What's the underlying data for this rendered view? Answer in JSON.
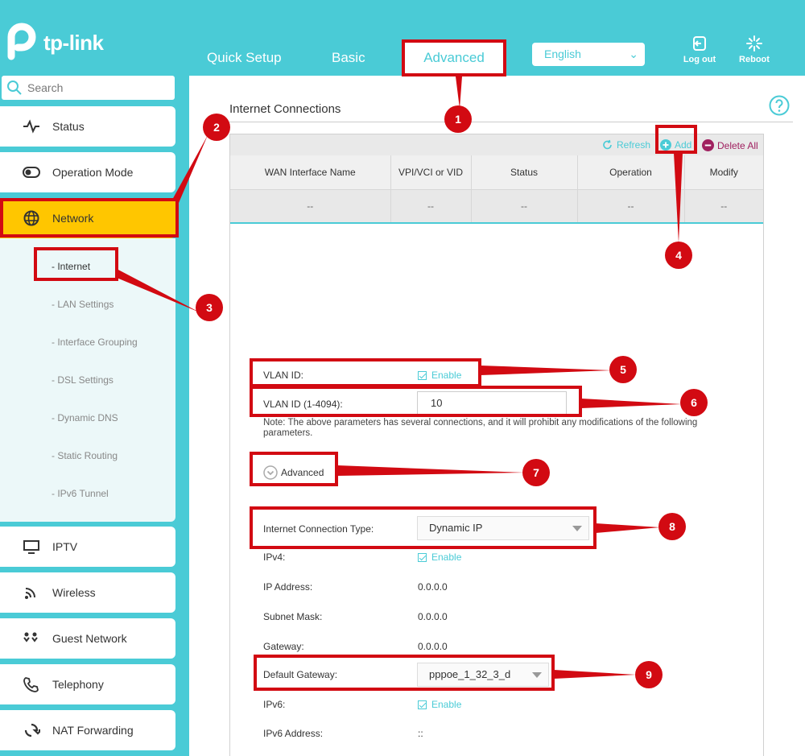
{
  "header": {
    "brand": "tp-link",
    "tabs": [
      {
        "label": "Quick Setup"
      },
      {
        "label": "Basic"
      },
      {
        "label": "Advanced"
      }
    ],
    "language": "English",
    "logout_label": "Log out",
    "reboot_label": "Reboot"
  },
  "sidebar": {
    "search_placeholder": "Search",
    "items": [
      {
        "label": "Status",
        "icon": "pulse-icon"
      },
      {
        "label": "Operation Mode",
        "icon": "toggle-icon"
      },
      {
        "label": "Network",
        "icon": "globe-icon"
      },
      {
        "label": "IPTV",
        "icon": "monitor-icon"
      },
      {
        "label": "Wireless",
        "icon": "wifi-icon"
      },
      {
        "label": "Guest Network",
        "icon": "guests-icon"
      },
      {
        "label": "Telephony",
        "icon": "phone-icon"
      },
      {
        "label": "NAT Forwarding",
        "icon": "nat-icon"
      }
    ],
    "network_sub": [
      "- Internet",
      "- LAN Settings",
      "- Interface Grouping",
      "- DSL Settings",
      "- Dynamic DNS",
      "- Static Routing",
      "- IPv6 Tunnel"
    ]
  },
  "main": {
    "section_title": "Internet Connections",
    "toolbar": {
      "refresh": "Refresh",
      "add": "Add",
      "delete_all": "Delete All"
    },
    "table": {
      "headers": [
        "WAN Interface Name",
        "VPI/VCI or VID",
        "Status",
        "Operation",
        "Modify"
      ],
      "rows": [
        [
          "--",
          "--",
          "--",
          "--",
          "--"
        ]
      ]
    },
    "form": {
      "vlan_id_label": "VLAN ID:",
      "vlan_enable": "Enable",
      "vlan_range_label": "VLAN ID (1-4094):",
      "vlan_value": "10",
      "note": "Note: The above parameters has several connections, and it will prohibit any modifications of the following parameters.",
      "advanced_label": "Advanced",
      "conn_type_label": "Internet Connection Type:",
      "conn_type_value": "Dynamic IP",
      "ipv4_label": "IPv4:",
      "ipv4_enable": "Enable",
      "ip_label": "IP Address:",
      "ip_value": "0.0.0.0",
      "mask_label": "Subnet Mask:",
      "mask_value": "0.0.0.0",
      "gw_label": "Gateway:",
      "gw_value": "0.0.0.0",
      "def_gw_label": "Default Gateway:",
      "def_gw_value": "pppoe_1_32_3_d",
      "ipv6_label": "IPv6:",
      "ipv6_enable": "Enable",
      "ipv6_addr_label": "IPv6 Address:",
      "ipv6_addr_value": "::"
    }
  },
  "annotations": {
    "labels": [
      "1",
      "2",
      "3",
      "4",
      "5",
      "6",
      "7",
      "8",
      "9"
    ],
    "color": "#d20a12"
  },
  "colors": {
    "brand": "#4acbd6",
    "active_menu": "#ffc600",
    "annotation": "#d20a12",
    "delete": "#a0205f"
  }
}
